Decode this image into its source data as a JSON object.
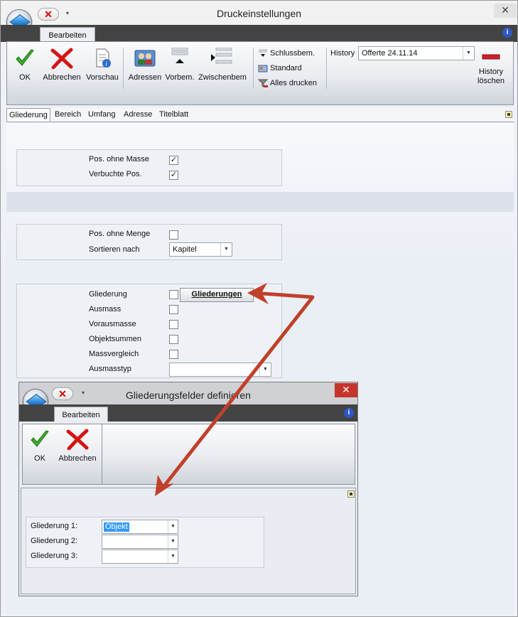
{
  "main": {
    "title": "Druckeinstellungen",
    "ribbon_tab": "Bearbeiten",
    "buttons": {
      "ok": "OK",
      "abbrechen": "Abbrechen",
      "vorschau": "Vorschau",
      "adressen": "Adressen",
      "vorbem": "Vorbem.",
      "zwischenbem": "Zwischenbem"
    },
    "small_buttons": {
      "schlussbem": "Schlussbem.",
      "standard": "Standard",
      "alles_drucken": "Alles drucken"
    },
    "history": {
      "label": "History",
      "value": "Offerte 24.11.14",
      "loeschen_line1": "History",
      "loeschen_line2": "löschen"
    },
    "tabs": [
      "Gliederung",
      "Bereich",
      "Umfang",
      "Adresse",
      "Titelblatt"
    ],
    "group1": {
      "pos_ohne_masse": "Pos. ohne Masse",
      "verbuchte_pos": "Verbuchte Pos."
    },
    "group2": {
      "pos_ohne_menge": "Pos. ohne Menge",
      "sortieren_nach": "Sortieren nach",
      "sortieren_value": "Kapitel"
    },
    "group3": {
      "gliederung": "Gliederung",
      "gliederungen_button": "Gliederungen",
      "ausmass": "Ausmass",
      "vorausmasse": "Vorausmasse",
      "objektsummen": "Objektsummen",
      "massvergleich": "Massvergleich",
      "ausmasstyp": "Ausmasstyp"
    }
  },
  "dialog": {
    "title": "Gliederungsfelder definieren",
    "ribbon_tab": "Bearbeiten",
    "buttons": {
      "ok": "OK",
      "abbrechen": "Abbrechen"
    },
    "fields": [
      {
        "label": "Gliederung 1:",
        "value": "Objekt"
      },
      {
        "label": "Gliederung 2:",
        "value": ""
      },
      {
        "label": "Gliederung 3:",
        "value": ""
      }
    ]
  },
  "colors": {
    "tabstrip": "#434343",
    "close_red": "#c4352b",
    "annotation_arrow": "#c0402a",
    "selection": "#3399ff"
  }
}
